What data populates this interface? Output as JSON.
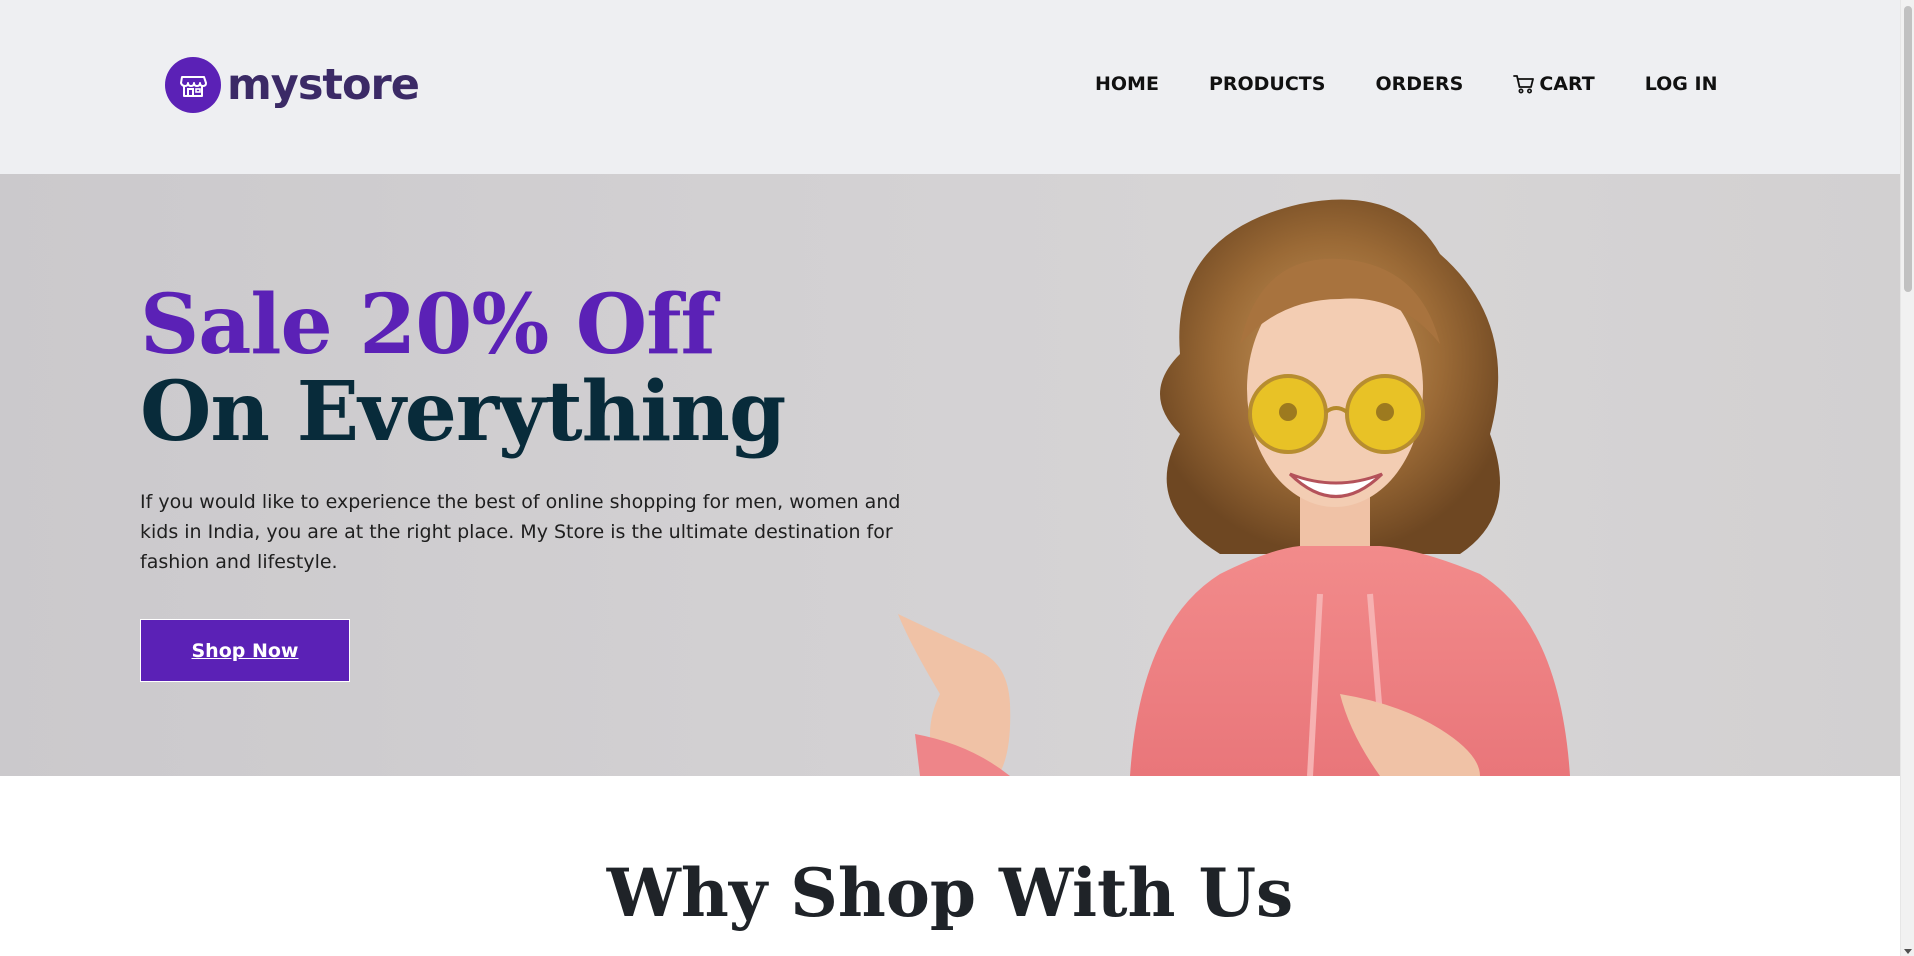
{
  "brand": {
    "name": "mystore",
    "accent": "#5b21b6",
    "dark": "#082b3a"
  },
  "nav": {
    "items": [
      {
        "label": "HOME"
      },
      {
        "label": "PRODUCTS"
      },
      {
        "label": "ORDERS"
      },
      {
        "label": "CART",
        "icon": "cart-icon"
      },
      {
        "label": "LOG IN"
      }
    ]
  },
  "hero": {
    "title_line1": "Sale 20% Off",
    "title_line2": "On Everything",
    "description": "If you would like to experience the best of online shopping for men, women and kids in India, you are at the right place. My Store is the ultimate destination for fashion and lifestyle.",
    "button_label": "Shop Now"
  },
  "section": {
    "title": "Why Shop With Us"
  }
}
